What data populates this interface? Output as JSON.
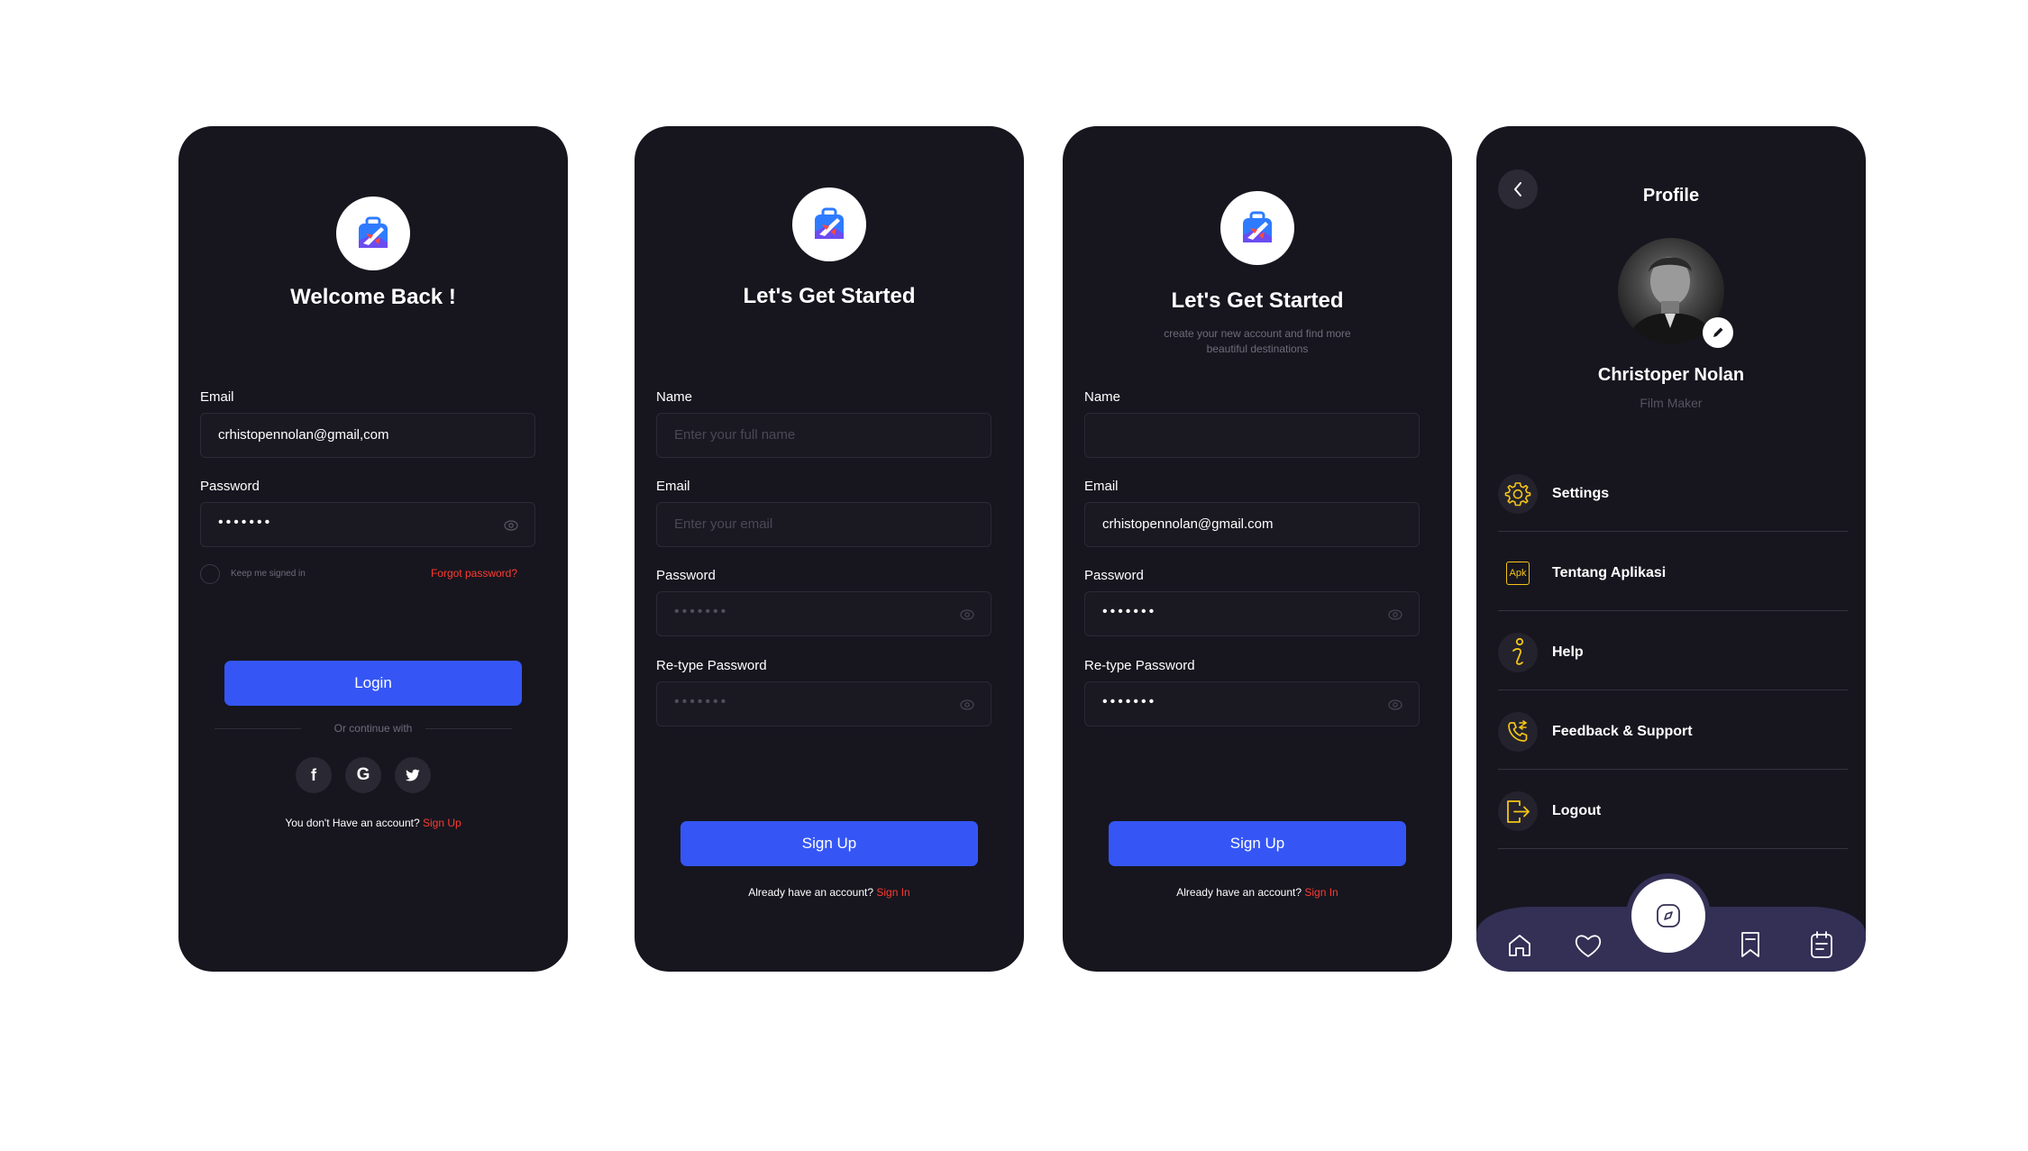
{
  "login": {
    "title": "Welcome Back !",
    "email_label": "Email",
    "email_value": "crhistopennolan@gmail,com",
    "password_label": "Password",
    "password_dots": "•••••••",
    "keep_signed_in": "Keep me signed in",
    "forgot": "Forgot password?",
    "login_button": "Login",
    "or_continue": "Or continue with",
    "social": [
      "f",
      "G",
      "t"
    ],
    "no_account": "You don't Have an account?",
    "sign_up_link": "Sign Up"
  },
  "signup_empty": {
    "title": "Let's Get Started",
    "name_label": "Name",
    "name_placeholder": "Enter your full name",
    "email_label": "Email",
    "email_placeholder": "Enter your email",
    "password_label": "Password",
    "password_dots": "•••••••",
    "retype_label": "Re-type Password",
    "retype_dots": "•••••••",
    "button": "Sign Up",
    "have_account": "Already have an account?",
    "sign_in_link": "Sign In"
  },
  "signup_filled": {
    "title": "Let's Get Started",
    "subtitle_line1": "create your new account and find more",
    "subtitle_line2": "beautiful destinations",
    "name_label": "Name",
    "name_value": "",
    "email_label": "Email",
    "email_value": "crhistopennolan@gmail.com",
    "password_label": "Password",
    "password_dots": "•••••••",
    "retype_label": "Re-type Password",
    "retype_dots": "•••••••",
    "button": "Sign Up",
    "have_account": "Already have an account?",
    "sign_in_link": "Sign In"
  },
  "profile": {
    "title": "Profile",
    "name": "Christoper Nolan",
    "role": "Film Maker",
    "menu": [
      {
        "label": "Settings",
        "icon": "gear-icon"
      },
      {
        "label": "Tentang Aplikasi",
        "icon": "apk-icon"
      },
      {
        "label": "Help",
        "icon": "info-icon"
      },
      {
        "label": "Feedback & Support",
        "icon": "phone-icon"
      },
      {
        "label": "Logout",
        "icon": "logout-icon"
      }
    ],
    "apk_text": "Apk",
    "nav": [
      "home-icon",
      "heart-icon",
      "compass-icon",
      "bookmark-icon",
      "calendar-icon"
    ]
  },
  "colors": {
    "accent": "#3556f5",
    "danger": "#ff3b30",
    "icon_yellow": "#f5c518",
    "card": "#17161f",
    "nav": "#332f55"
  }
}
